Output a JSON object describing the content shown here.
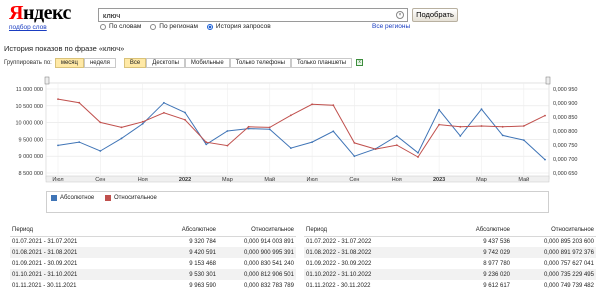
{
  "header": {
    "logo_text": "Яндекс",
    "subtitle": "подбор слов",
    "search_value": "ключ",
    "search_button": "Подобрать",
    "radios": [
      {
        "label": "По словам",
        "selected": false
      },
      {
        "label": "По регионам",
        "selected": false
      },
      {
        "label": "История запросов",
        "selected": true
      }
    ],
    "all_regions": "Все регионы"
  },
  "page_title": "История показов по фразе «ключ»",
  "toolbar": {
    "group_label": "Группировать по:",
    "group_buttons": [
      {
        "label": "месяц",
        "selected": true
      },
      {
        "label": "неделя",
        "selected": false
      }
    ],
    "device_buttons": [
      {
        "label": "Все",
        "selected": true
      },
      {
        "label": "Десктопы",
        "selected": false
      },
      {
        "label": "Мобильные",
        "selected": false
      },
      {
        "label": "Только телефоны",
        "selected": false
      },
      {
        "label": "Только планшеты",
        "selected": false
      }
    ]
  },
  "chart_data": {
    "type": "line",
    "x": [
      "Июл 2021",
      "Авг 2021",
      "Сен 2021",
      "Окт 2021",
      "Ноя 2021",
      "Дек 2021",
      "Янв 2022",
      "Фев 2022",
      "Мар 2022",
      "Апр 2022",
      "Май 2022",
      "Июн 2022",
      "Июл 2022",
      "Авг 2022",
      "Сен 2022",
      "Окт 2022",
      "Ноя 2022",
      "Дек 2022",
      "Янв 2023",
      "Фев 2023",
      "Мар 2023",
      "Апр 2023",
      "Май 2023",
      "Июн 2023"
    ],
    "x_tick_labels": [
      {
        "label": "Июл",
        "bold": false,
        "index": 0
      },
      {
        "label": "Сен",
        "bold": false,
        "index": 2
      },
      {
        "label": "Ноя",
        "bold": false,
        "index": 4
      },
      {
        "label": "2022",
        "bold": true,
        "index": 6
      },
      {
        "label": "Мар",
        "bold": false,
        "index": 8
      },
      {
        "label": "Май",
        "bold": false,
        "index": 10
      },
      {
        "label": "Июл",
        "bold": false,
        "index": 12
      },
      {
        "label": "Сен",
        "bold": false,
        "index": 14
      },
      {
        "label": "Ноя",
        "bold": false,
        "index": 16
      },
      {
        "label": "2023",
        "bold": true,
        "index": 18
      },
      {
        "label": "Мар",
        "bold": false,
        "index": 20
      },
      {
        "label": "Май",
        "bold": false,
        "index": 22
      }
    ],
    "series": [
      {
        "name": "Абсолютное",
        "axis": "left",
        "color": "#3f74b6",
        "values": [
          9320784,
          9420591,
          9153468,
          9530301,
          9963590,
          10590000,
          10300000,
          9350000,
          9750000,
          9820000,
          9800000,
          9240000,
          9420000,
          9740000,
          9000000,
          9220000,
          9600000,
          9100000,
          10380000,
          9600000,
          10400000,
          9620000,
          9480000,
          8900000
        ]
      },
      {
        "name": "Относительное",
        "axis": "right",
        "color": "#c0504d",
        "values": [
          0.000914003891,
          0.000900995391,
          0.00083054124,
          0.000813,
          0.000832783789,
          0.000865,
          0.00084,
          0.00076,
          0.000748,
          0.000815,
          0.000813,
          0.000856,
          0.0008952036,
          0.000891972376,
          0.000757627041,
          0.000735229495,
          0.000749739482,
          0.000707,
          0.000823,
          0.000815,
          0.000818,
          0.000815,
          0.000818,
          0.000855
        ]
      }
    ],
    "y_left": {
      "range": [
        8500000,
        11000000
      ],
      "tick_labels": [
        "11 000 000",
        "10 500 000",
        "10 000 000",
        "9 500 000",
        "9 000 000",
        "8 500 000"
      ]
    },
    "y_right": {
      "range": [
        0.00065,
        0.00095
      ],
      "tick_labels": [
        "0,000 950",
        "0,000 900",
        "0,000 850",
        "0,000 800",
        "0,000 750",
        "0,000 700",
        "0,000 650"
      ]
    },
    "grid": true,
    "legend": "bottom-left"
  },
  "table": {
    "left": {
      "headers": {
        "period": "Период",
        "abs": "Абсолютное",
        "rel": "Относительное"
      },
      "rows": [
        {
          "period": "01.07.2021 - 31.07.2021",
          "abs": "9 320 784",
          "rel": "0,000 914 003 891"
        },
        {
          "period": "01.08.2021 - 31.08.2021",
          "abs": "9 420 591",
          "rel": "0,000 900 995 391"
        },
        {
          "period": "01.09.2021 - 30.09.2021",
          "abs": "9 153 468",
          "rel": "0,000 830 541 240"
        },
        {
          "period": "01.10.2021 - 31.10.2021",
          "abs": "9 530 301",
          "rel": "0,000 812 906 501"
        },
        {
          "period": "01.11.2021 - 30.11.2021",
          "abs": "9 963 590",
          "rel": "0,000 832 783 789"
        }
      ]
    },
    "right": {
      "headers": {
        "period": "Период",
        "abs": "Абсолютное",
        "rel": "Относительное"
      },
      "rows": [
        {
          "period": "01.07.2022 - 31.07.2022",
          "abs": "9 437 536",
          "rel": "0,000 895 203 600"
        },
        {
          "period": "01.08.2022 - 31.08.2022",
          "abs": "9 742 029",
          "rel": "0,000 891 972 376"
        },
        {
          "period": "01.09.2022 - 30.09.2022",
          "abs": "8 977 780",
          "rel": "0,000 757 627 041"
        },
        {
          "period": "01.10.2022 - 31.10.2022",
          "abs": "9 236 020",
          "rel": "0,000 735 229 495"
        },
        {
          "period": "01.11.2022 - 30.11.2022",
          "abs": "9 612 617",
          "rel": "0,000 749 739 482"
        }
      ]
    }
  }
}
